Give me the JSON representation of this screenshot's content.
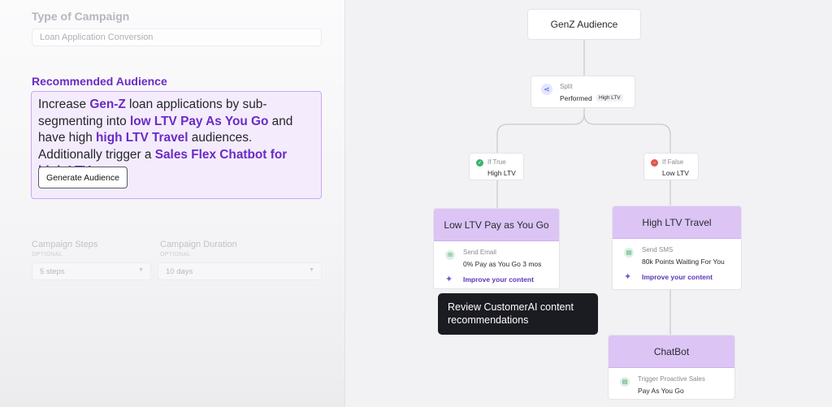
{
  "left": {
    "type_of_campaign_label": "Type of Campaign",
    "type_of_campaign_value": "Loan Application Conversion",
    "recommended_label": "Recommended Audience",
    "reco_parts": {
      "p1": "Increase ",
      "b1": "Gen-Z",
      "p2": " loan applications by sub-segmenting into ",
      "b2": "low LTV Pay As You Go",
      "p3": " and have high ",
      "b3": "high LTV Travel",
      "p4": " audiences. Additionally trigger a ",
      "b4": "Sales Flex Chatbot for high LTV"
    },
    "generate_button": "Generate Audience",
    "steps_label": "Campaign Steps",
    "steps_sub": "OPTIONAL",
    "steps_value": "5 steps",
    "duration_label": "Campaign Duration",
    "duration_sub": "OPTIONAL",
    "duration_value": "10 days"
  },
  "flow": {
    "root": "GenZ Audience",
    "split": {
      "label": "Split",
      "value": "Performed",
      "tag": "High LTV"
    },
    "if_true": {
      "label": "If True",
      "value": "High LTV"
    },
    "if_false": {
      "label": "If False",
      "value": "Low LTV"
    },
    "low_card": {
      "title": "Low LTV Pay as You Go",
      "action_label": "Send Email",
      "action_value": "0% Pay as You Go 3 mos",
      "improve": "Improve your content"
    },
    "high_card": {
      "title": "High LTV Travel",
      "action_label": "Send SMS",
      "action_value": "80k Points Waiting For You",
      "improve": "Improve your content"
    },
    "chat_card": {
      "title": "ChatBot",
      "action_label": "Trigger Proactive Sales",
      "action_value": "Pay As You Go"
    },
    "tooltip": "Review CustomerAI content recommendations"
  },
  "colors": {
    "accent_purple": "#6a2bc6",
    "card_header": "#dcc4f5",
    "true_green": "#3bb36b",
    "false_red": "#e0554a"
  },
  "icons": [
    "split-icon",
    "check-icon",
    "minus-icon",
    "email-icon",
    "sms-icon",
    "sparkle-icon",
    "chevron-down-icon"
  ]
}
